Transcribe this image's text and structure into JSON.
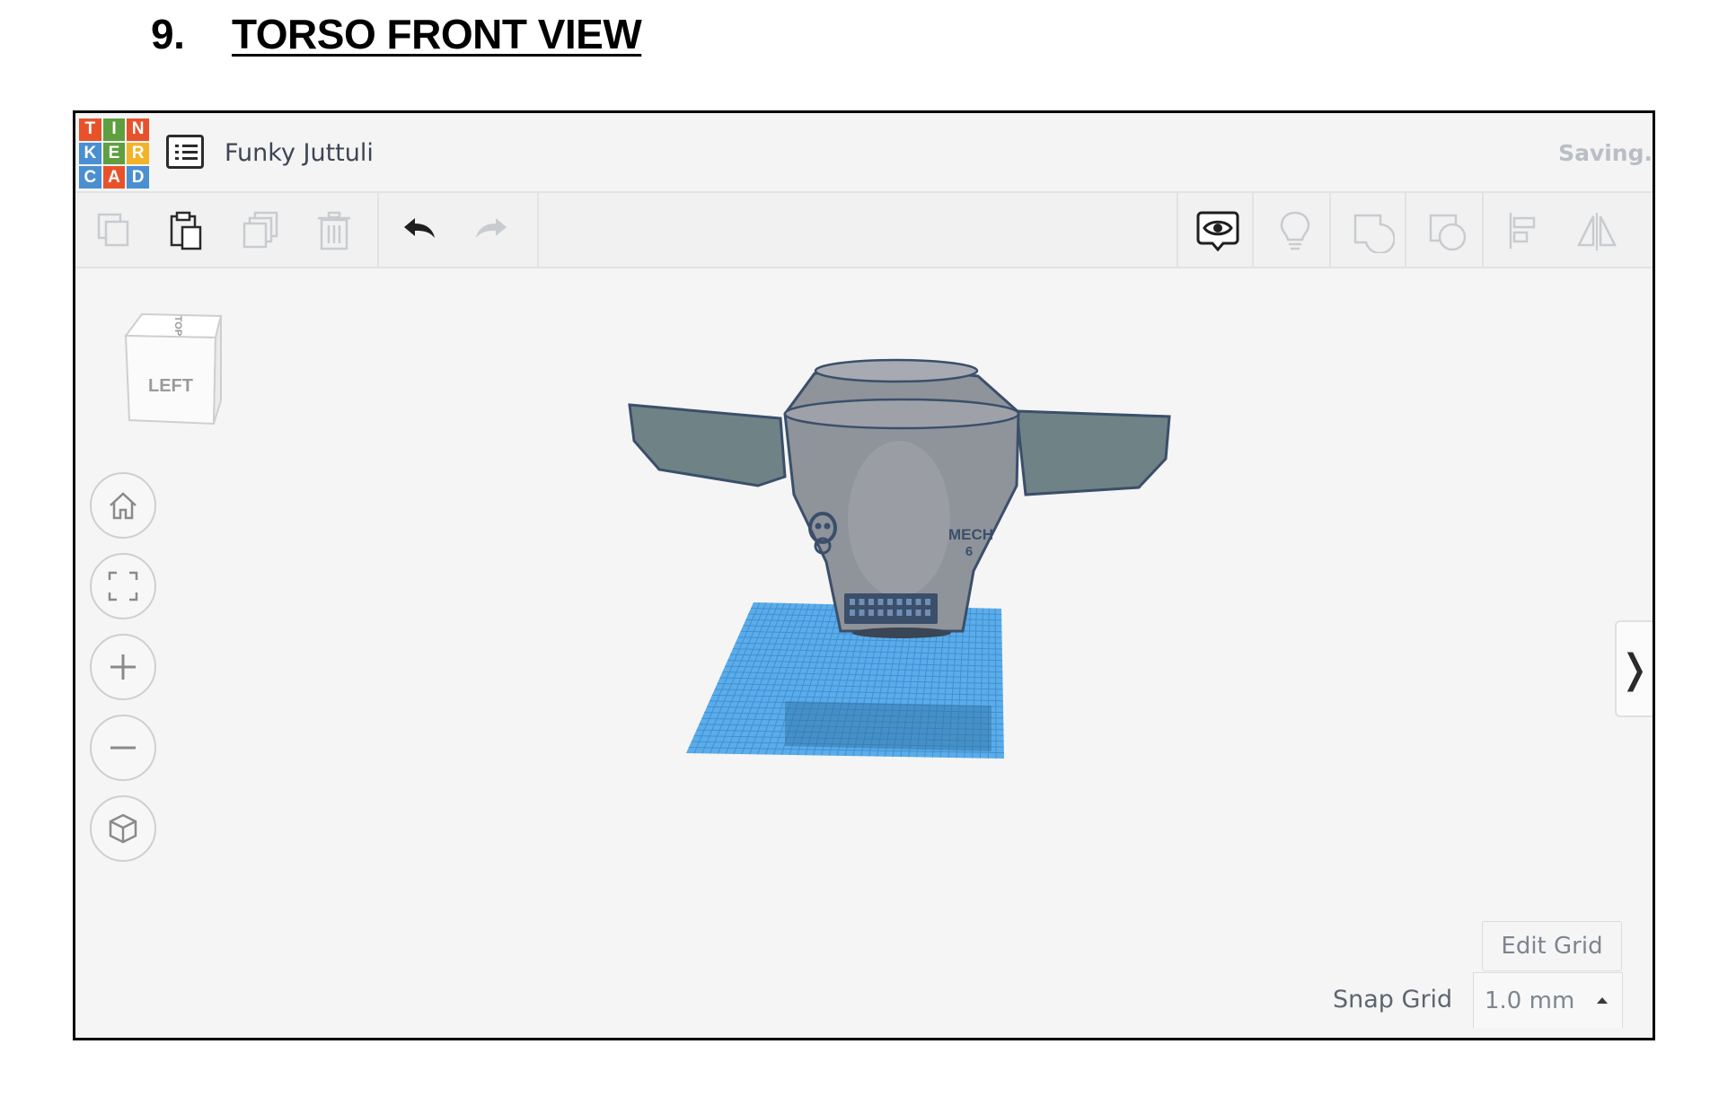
{
  "heading": {
    "number": "9.",
    "title": "TORSO FRONT VIEW"
  },
  "app": {
    "logo_letters": [
      "T",
      "I",
      "N",
      "K",
      "E",
      "R",
      "C",
      "A",
      "D"
    ],
    "logo_colors": [
      "#e8522b",
      "#5f9f3f",
      "#e8522b",
      "#4a8fd1",
      "#5f9f3f",
      "#f2b32a",
      "#4a8fd1",
      "#e8522b",
      "#4a8fd1"
    ],
    "project_name": "Funky Juttuli",
    "save_status": "Saving."
  },
  "toolbar": {
    "left": [
      {
        "name": "copy-icon",
        "enabled": false
      },
      {
        "name": "paste-icon",
        "enabled": true
      },
      {
        "name": "duplicate-icon",
        "enabled": false
      },
      {
        "name": "delete-icon",
        "enabled": false
      },
      {
        "name": "undo-icon",
        "enabled": true
      },
      {
        "name": "redo-icon",
        "enabled": false
      }
    ],
    "right": [
      {
        "name": "show-all-icon",
        "enabled": true
      },
      {
        "name": "notes-icon",
        "enabled": false
      },
      {
        "name": "group-icon",
        "enabled": false
      },
      {
        "name": "ungroup-icon",
        "enabled": false
      },
      {
        "name": "align-icon",
        "enabled": false
      },
      {
        "name": "mirror-icon",
        "enabled": false
      }
    ]
  },
  "viewcube": {
    "front_face": "LEFT",
    "top_face": "TOP"
  },
  "nav_buttons": [
    "home-view-icon",
    "fit-all-icon",
    "zoom-in-icon",
    "zoom-out-icon",
    "perspective-icon"
  ],
  "model": {
    "left_emblem": "skull",
    "right_text_line1": "MECH",
    "right_text_line2": "6"
  },
  "colors": {
    "accent": "#4a8fd1",
    "workplane_blue": "#3f9fe6",
    "model_gray": "#8f939a",
    "model_outline": "#3b4f6b"
  },
  "side_panel_toggle": "❭",
  "grid": {
    "edit_grid_label": "Edit Grid",
    "snap_grid_label": "Snap Grid",
    "snap_grid_value": "1.0 mm"
  }
}
